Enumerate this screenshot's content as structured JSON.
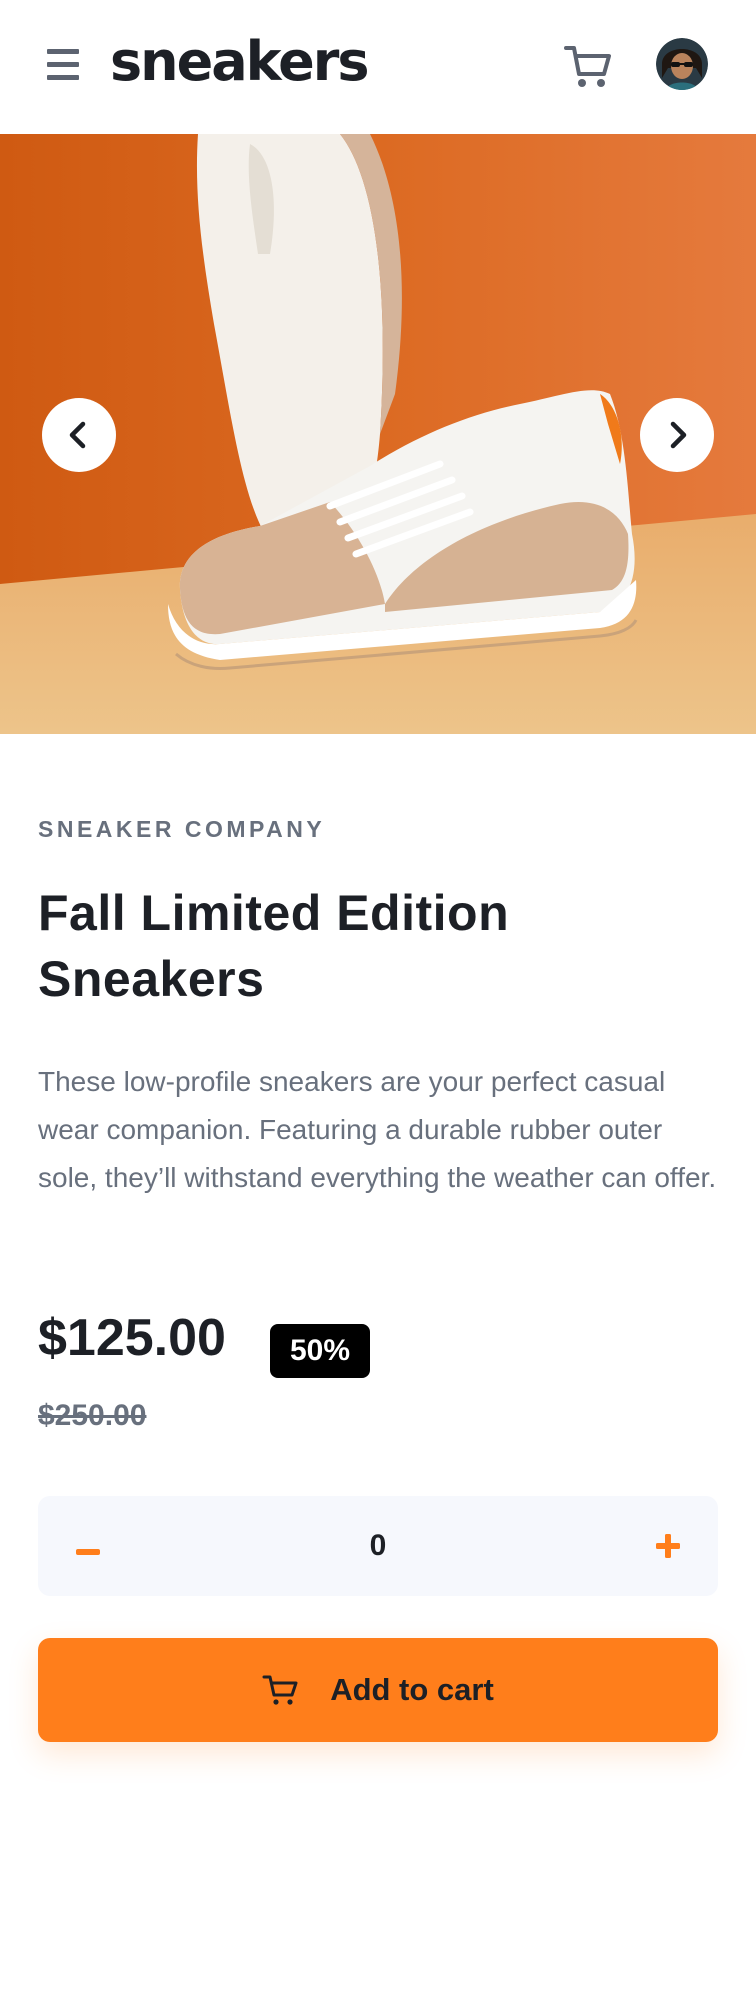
{
  "header": {
    "logo": "sneakers",
    "menu_icon": "hamburger-menu-icon",
    "cart_icon": "cart-icon",
    "avatar_alt": "user avatar"
  },
  "gallery": {
    "prev_icon": "chevron-left-icon",
    "next_icon": "chevron-right-icon"
  },
  "product": {
    "company": "SNEAKER COMPANY",
    "title": "Fall Limited Edition Sneakers",
    "description": "These low-profile sneakers are your perfect casual wear companion. Featuring a durable rubber outer sole, they’ll withstand everything the weather can offer.",
    "price": "$125.00",
    "discount": "50%",
    "original_price": "$250.00"
  },
  "quantity": {
    "value": "0",
    "minus_icon": "minus-icon",
    "plus_icon": "plus-icon"
  },
  "add_to_cart": {
    "label": "Add to cart",
    "icon": "cart-icon"
  },
  "colors": {
    "accent": "#ff7e1b",
    "text_dark": "#1d2026",
    "text_gray": "#68707d",
    "qty_bg": "#f6f8fd"
  }
}
